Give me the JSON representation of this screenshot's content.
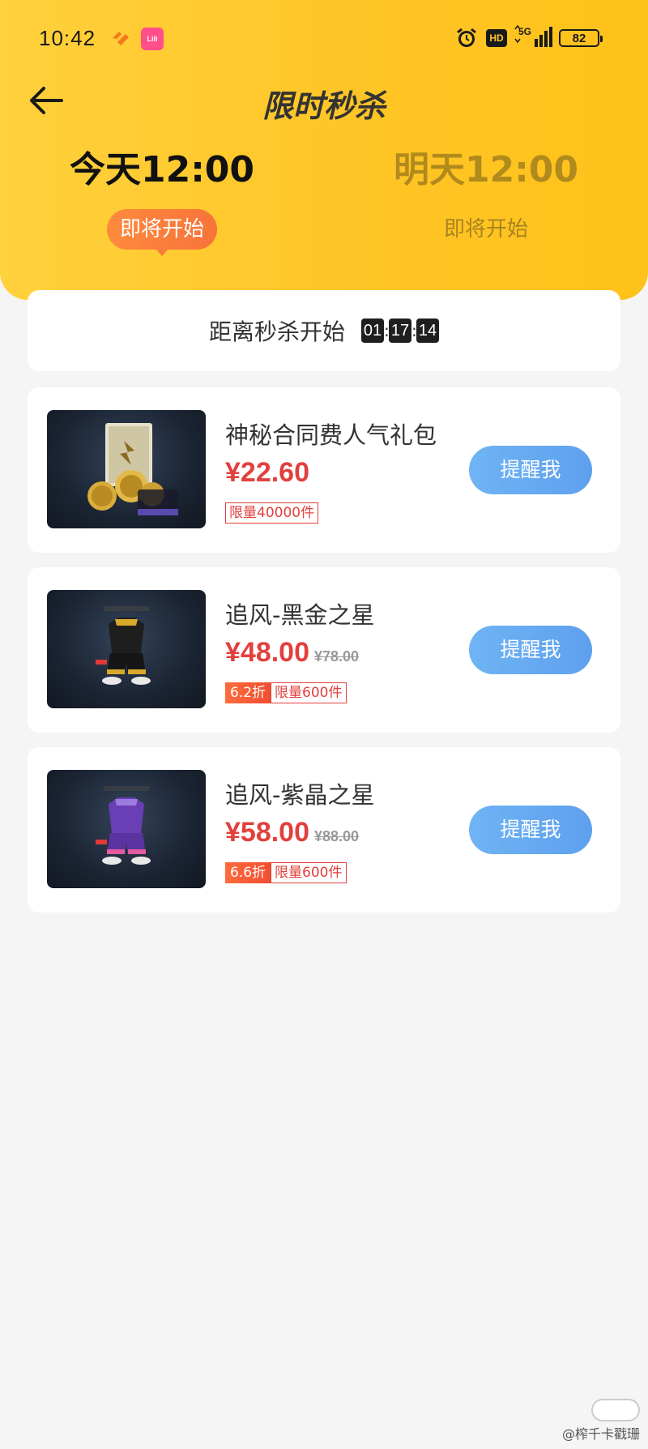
{
  "status_bar": {
    "time": "10:42",
    "app_badge": "Lili",
    "hd": "HD",
    "network": "5G",
    "battery": "82"
  },
  "header": {
    "title": "限时秒杀"
  },
  "sessions": [
    {
      "time": "今天12:00",
      "status": "即将开始",
      "active": true
    },
    {
      "time": "明天12:00",
      "status": "即将开始",
      "active": false
    }
  ],
  "countdown": {
    "label": "距离秒杀开始",
    "hours": "01",
    "minutes": "17",
    "seconds": "14",
    "separator": ":"
  },
  "products": [
    {
      "name": "神秘合同费人气礼包",
      "price": "¥22.60",
      "original_price": "",
      "discount": "",
      "limit": "限量40000件",
      "button": "提醒我"
    },
    {
      "name": "追风-黑金之星",
      "price": "¥48.00",
      "original_price": "¥78.00",
      "discount": "6.2折",
      "limit": "限量600件",
      "button": "提醒我"
    },
    {
      "name": "追风-紫晶之星",
      "price": "¥58.00",
      "original_price": "¥88.00",
      "discount": "6.6折",
      "limit": "限量600件",
      "button": "提醒我"
    }
  ],
  "watermark": "@榨千卡戳珊",
  "colors": {
    "header_bg": "#ffc926",
    "accent_red": "#e2403d",
    "button_blue": "#62a7f0",
    "pill_orange": "#f87d3b"
  }
}
